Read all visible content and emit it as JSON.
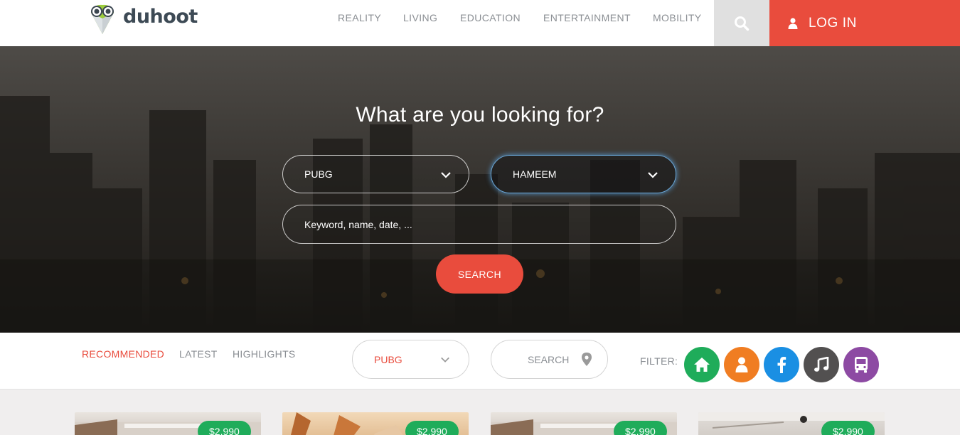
{
  "brand": {
    "name": "duhoot"
  },
  "nav": {
    "items": [
      {
        "label": "REALITY"
      },
      {
        "label": "LIVING"
      },
      {
        "label": "EDUCATION"
      },
      {
        "label": "ENTERTAINMENT"
      },
      {
        "label": "MOBILITY"
      }
    ],
    "search_icon": "search-icon",
    "login_label": "LOG IN",
    "login_icon": "user-icon"
  },
  "hero": {
    "title": "What are you looking for?",
    "category_select": {
      "value": "PUBG"
    },
    "location_select": {
      "value": "HAMEEM"
    },
    "keyword_placeholder": "Keyword, name, date, ...",
    "search_label": "SEARCH"
  },
  "filterbar": {
    "tabs": [
      {
        "label": "RECOMMENDED",
        "active": true
      },
      {
        "label": "LATEST",
        "active": false
      },
      {
        "label": "HIGHLIGHTS",
        "active": false
      }
    ],
    "category_value": "PUBG",
    "search_placeholder": "SEARCH",
    "filter_label": "FILTER:",
    "filters": [
      {
        "icon": "home-icon",
        "color": "#1fac5a"
      },
      {
        "icon": "person-icon",
        "color": "#f07d22"
      },
      {
        "icon": "facebook-icon",
        "color": "#1a8fe3"
      },
      {
        "icon": "music-icon",
        "color": "#525050"
      },
      {
        "icon": "bus-icon",
        "color": "#8d4aa3"
      }
    ]
  },
  "cards": [
    {
      "price": "$2,990"
    },
    {
      "price": "$2,990"
    },
    {
      "price": "$2,990"
    },
    {
      "price": "$2,990"
    }
  ],
  "colors": {
    "accent": "#e94c3d",
    "price_badge": "#1fac5a",
    "text_muted": "#8b8f94"
  }
}
